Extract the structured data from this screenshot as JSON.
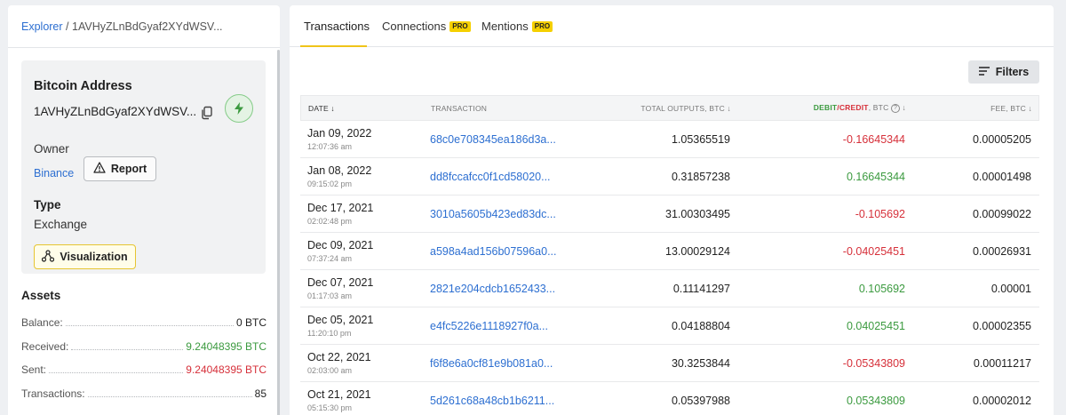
{
  "breadcrumb": {
    "root": "Explorer",
    "separator": "/",
    "current": "1AVHyZLnBdGyaf2XYdWSV..."
  },
  "address_card": {
    "title": "Bitcoin Address",
    "address": "1AVHyZLnBdGyaf2XYdWSV...",
    "copy_icon": "copy-icon",
    "bolt_icon": "lightning-icon",
    "owner_label": "Owner",
    "owner_value": "Binance",
    "report_label": "Report",
    "type_label": "Type",
    "type_value": "Exchange",
    "visualization_label": "Visualization"
  },
  "assets": {
    "title": "Assets",
    "rows": [
      {
        "label": "Balance:",
        "value": "0 BTC",
        "color": "default"
      },
      {
        "label": "Received:",
        "value": "9.24048395 BTC",
        "color": "green"
      },
      {
        "label": "Sent:",
        "value": "9.24048395 BTC",
        "color": "red"
      },
      {
        "label": "Transactions:",
        "value": "85",
        "color": "default"
      }
    ]
  },
  "tabs": [
    {
      "label": "Transactions",
      "active": true,
      "pro": ""
    },
    {
      "label": "Connections",
      "active": false,
      "pro": "PRO"
    },
    {
      "label": "Mentions",
      "active": false,
      "pro": "PRO"
    }
  ],
  "filters_label": "Filters",
  "table": {
    "headers": {
      "date": "DATE",
      "transaction": "TRANSACTION",
      "total_outputs": "TOTAL OUTPUTS, BTC",
      "debit": "DEBIT",
      "slash": "/",
      "credit": "CREDIT",
      "dc_suffix": ", BTC",
      "help": "?",
      "fee": "FEE, BTC"
    },
    "rows": [
      {
        "date": "Jan 09, 2022",
        "time": "12:07:36 am",
        "tx": "68c0e708345ea186d3a...",
        "outputs": "1.05365519",
        "dc": "-0.16645344",
        "dc_sign": "neg",
        "fee": "0.00005205"
      },
      {
        "date": "Jan 08, 2022",
        "time": "09:15:02 pm",
        "tx": "dd8fccafcc0f1cd58020...",
        "outputs": "0.31857238",
        "dc": "0.16645344",
        "dc_sign": "pos",
        "fee": "0.00001498"
      },
      {
        "date": "Dec 17, 2021",
        "time": "02:02:48 pm",
        "tx": "3010a5605b423ed83dc...",
        "outputs": "31.00303495",
        "dc": "-0.105692",
        "dc_sign": "neg",
        "fee": "0.00099022"
      },
      {
        "date": "Dec 09, 2021",
        "time": "07:37:24 am",
        "tx": "a598a4ad156b07596a0...",
        "outputs": "13.00029124",
        "dc": "-0.04025451",
        "dc_sign": "neg",
        "fee": "0.00026931"
      },
      {
        "date": "Dec 07, 2021",
        "time": "01:17:03 am",
        "tx": "2821e204cdcb1652433...",
        "outputs": "0.11141297",
        "dc": "0.105692",
        "dc_sign": "pos",
        "fee": "0.00001"
      },
      {
        "date": "Dec 05, 2021",
        "time": "11:20:10 pm",
        "tx": "e4fc5226e1118927f0a...",
        "outputs": "0.04188804",
        "dc": "0.04025451",
        "dc_sign": "pos",
        "fee": "0.00002355"
      },
      {
        "date": "Oct 22, 2021",
        "time": "02:03:00 am",
        "tx": "f6f8e6a0cf81e9b081a0...",
        "outputs": "30.3253844",
        "dc": "-0.05343809",
        "dc_sign": "neg",
        "fee": "0.00011217"
      },
      {
        "date": "Oct 21, 2021",
        "time": "05:15:30 pm",
        "tx": "5d261c68a48cb1b6211...",
        "outputs": "0.05397988",
        "dc": "0.05343809",
        "dc_sign": "pos",
        "fee": "0.00002012"
      }
    ]
  },
  "colors": {
    "link": "#2d6fd1",
    "positive": "#3b9a3f",
    "negative": "#d6303a",
    "accent": "#f0c419"
  }
}
